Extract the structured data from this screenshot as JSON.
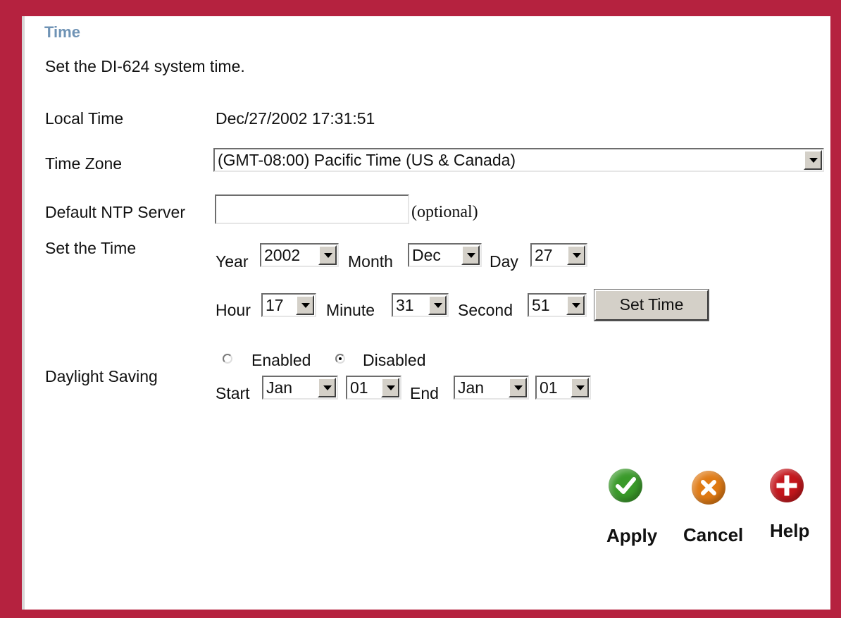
{
  "header": {
    "title": "Time",
    "subtitle": "Set the DI-624 system time."
  },
  "local_time": {
    "label": "Local Time",
    "value": "Dec/27/2002 17:31:51"
  },
  "time_zone": {
    "label": "Time Zone",
    "selected": "(GMT-08:00) Pacific Time (US & Canada)"
  },
  "ntp": {
    "label": "Default NTP Server",
    "value": "",
    "note": "(optional)"
  },
  "set_time": {
    "label": "Set the Time",
    "year_label": "Year",
    "year": "2002",
    "month_label": "Month",
    "month": "Dec",
    "day_label": "Day",
    "day": "27",
    "hour_label": "Hour",
    "hour": "17",
    "minute_label": "Minute",
    "minute": "31",
    "second_label": "Second",
    "second": "51",
    "button": "Set Time"
  },
  "daylight": {
    "label": "Daylight Saving",
    "enabled_label": "Enabled",
    "disabled_label": "Disabled",
    "selected": "Disabled",
    "start_label": "Start",
    "start_month": "Jan",
    "start_day": "01",
    "end_label": "End",
    "end_month": "Jan",
    "end_day": "01"
  },
  "actions": {
    "apply": "Apply",
    "cancel": "Cancel",
    "help": "Help"
  },
  "colors": {
    "frame": "#b5223f",
    "title": "#6f93b5",
    "apply_icon": "#3a9a2a",
    "cancel_icon": "#e07a14",
    "help_icon": "#c4161c"
  }
}
